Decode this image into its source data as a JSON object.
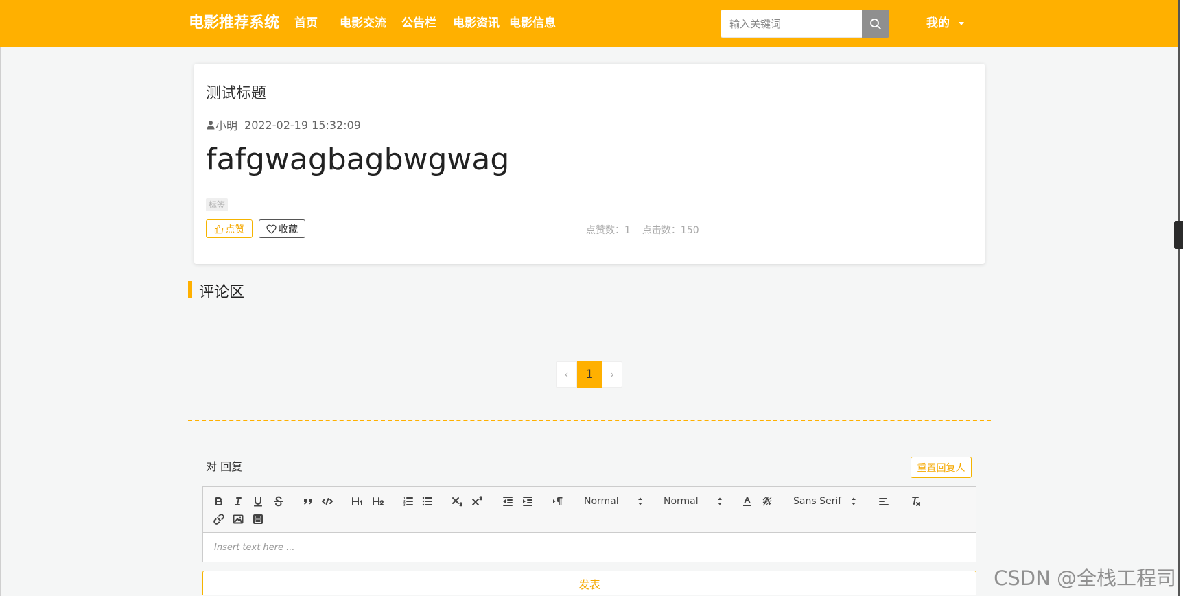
{
  "colors": {
    "primary": "#ffb000",
    "page_background": "#f5f6f6",
    "search_button": "#8f8f8f",
    "muted_text": "#aaaaaa"
  },
  "header": {
    "brand": "电影推荐系统",
    "nav": [
      {
        "label": "首页"
      },
      {
        "label": "电影交流"
      },
      {
        "label": "公告栏"
      },
      {
        "label": "电影资讯"
      },
      {
        "label": "电影信息"
      }
    ],
    "search": {
      "placeholder": "输入关键词",
      "value": "",
      "icon": "search-icon"
    },
    "user_menu": {
      "label": "我的",
      "icon": "caret-down-icon"
    }
  },
  "post": {
    "title": "测试标题",
    "author": "小明",
    "author_icon": "user-icon",
    "date": "2022-02-19 15:32:09",
    "content": "fafgwagbagbwgwag",
    "tag": "标签",
    "like_button": {
      "label": "点赞",
      "icon": "thumbs-up-icon"
    },
    "favorite_button": {
      "label": "收藏",
      "icon": "heart-icon"
    },
    "stats": {
      "likes": "点赞数：1",
      "clicks": "点击数：150"
    }
  },
  "comments": {
    "heading": "评论区",
    "pagination": {
      "prev": "‹",
      "current": "1",
      "next": "›"
    }
  },
  "reply": {
    "target_label": "对 回复",
    "reset_button": "重置回复人",
    "editor": {
      "toolbar_icons": [
        "bold-icon",
        "italic-icon",
        "underline-icon",
        "strike-icon",
        "blockquote-icon",
        "code-block-icon",
        "header-1-icon",
        "header-2-icon",
        "ordered-list-icon",
        "bullet-list-icon",
        "subscript-icon",
        "superscript-icon",
        "outdent-icon",
        "indent-icon",
        "direction-icon",
        "text-color-icon",
        "background-color-icon",
        "align-left-icon",
        "clean-format-icon",
        "link-icon",
        "image-icon",
        "video-icon"
      ],
      "size_value": "Normal",
      "header_value": "Normal",
      "font_value": "Sans Serif",
      "placeholder": "Insert text here ..."
    },
    "submit_button": "发表"
  },
  "watermark": "CSDN @全栈工程司"
}
